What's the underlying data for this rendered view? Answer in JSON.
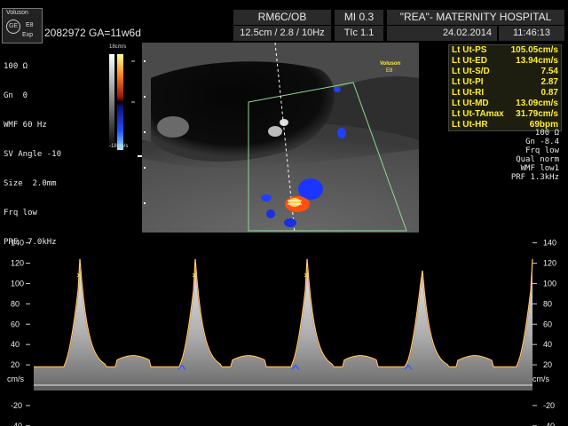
{
  "header": {
    "brand_top": "Voluson",
    "brand_model": "E8",
    "brand_sub": "Exp",
    "probe_preset": "RM6C/OB",
    "mi": "MI 0.3",
    "hospital": "\"REA\"- MATERNITY HOSPITAL",
    "depth_info": "12.5cm / 2.8 / 10Hz",
    "tic": "TIc 1.1",
    "date": "24.02.2014",
    "time": "11:46:13"
  },
  "patient": {
    "id_ga": "2082972  GA=11w6d"
  },
  "left_params": [
    "100 Ω",
    "Gn  0",
    "WMF 60 Hz",
    "SV Angle -10",
    "Size  2.0mm",
    "Frq low",
    "PRF  7.0kHz"
  ],
  "colorbar": {
    "top": "18cm/s",
    "bottom": "-18cm/s"
  },
  "image_overlay": {
    "brand": "Voluson",
    "model": "E8"
  },
  "measurements": [
    {
      "label": "Lt Ut-PS",
      "value": "105.05cm/s"
    },
    {
      "label": "Lt Ut-ED",
      "value": "13.94cm/s"
    },
    {
      "label": "Lt Ut-S/D",
      "value": "7.54"
    },
    {
      "label": "Lt Ut-PI",
      "value": "2.87"
    },
    {
      "label": "Lt Ut-RI",
      "value": "0.87"
    },
    {
      "label": "Lt Ut-MD",
      "value": "13.09cm/s"
    },
    {
      "label": "Lt Ut-TAmax",
      "value": "31.79cm/s"
    },
    {
      "label": "Lt Ut-HR",
      "value": "69bpm"
    }
  ],
  "right_params": [
    "100 Ω",
    "Gn -8.4",
    "Frq low",
    "Qual norm",
    "WMF low1",
    "PRF  1.3kHz"
  ],
  "doppler": {
    "unit_left": "cm/s",
    "unit_right": "cm/s",
    "ticks": [
      "140",
      "120",
      "100",
      "80",
      "60",
      "40",
      "20",
      "-20",
      "-40"
    ],
    "tick_values": [
      140,
      120,
      100,
      80,
      60,
      40,
      20,
      -20,
      -40
    ]
  },
  "colors": {
    "measure_text": "#ffee33",
    "trace_red": "#c62828",
    "trace_yellow": "#e8e27a"
  }
}
